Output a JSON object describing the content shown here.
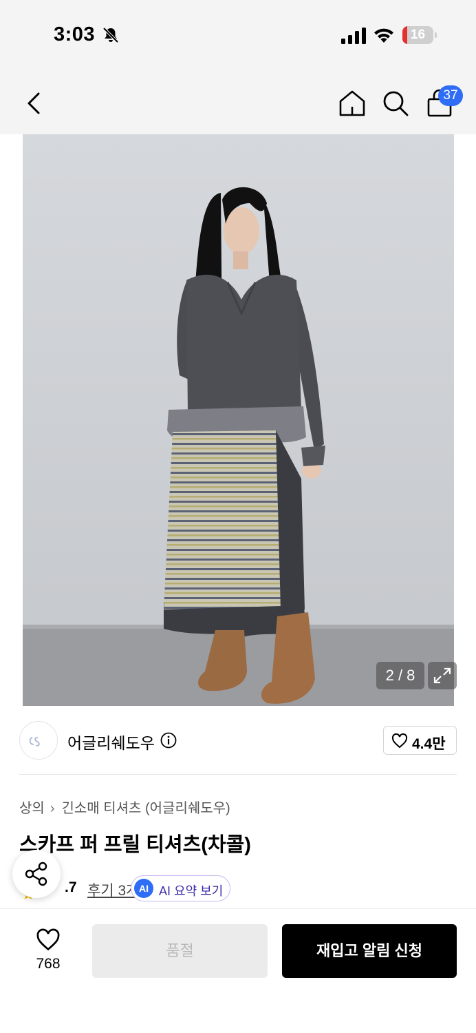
{
  "status_bar": {
    "time": "3:03",
    "battery_level": "16",
    "battery_fraction": 0.16
  },
  "nav": {
    "icons": [
      "back-arrow-icon",
      "home-icon",
      "search-icon",
      "shopping-bag-icon"
    ],
    "cart_badge": "37"
  },
  "gallery": {
    "counter": "2 / 8",
    "expand_icon": "expand-icon"
  },
  "brand": {
    "name": "어글리쉐도우",
    "like_count": "4.4만"
  },
  "product": {
    "breadcrumb": [
      "상의",
      "긴소매 티셔츠 (어글리쉐도우)"
    ],
    "title": "스카프 퍼 프릴 티셔츠(차콜)",
    "rating": ".7",
    "review_link": "후기 3개",
    "ai_badge": "AI",
    "ai_summary": "AI 요약 보기"
  },
  "bottom_bar": {
    "wish_count": "768",
    "soldout_label": "품절",
    "restock_label": "재입고 알림 신청"
  },
  "colors": {
    "accent_blue": "#2f6df6",
    "primary_button": "#000000",
    "disabled_button": "#ebebeb",
    "battery_low": "#e4312d"
  }
}
